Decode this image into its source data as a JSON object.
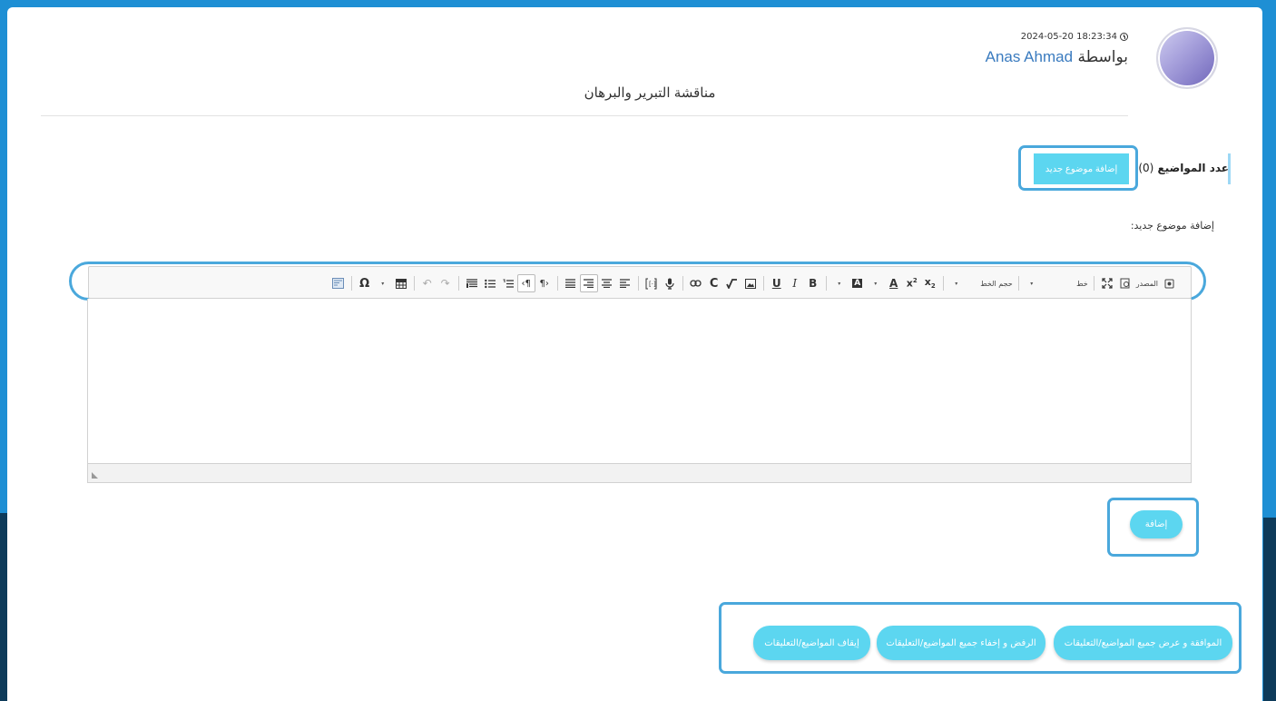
{
  "post": {
    "datetime": "2024-05-20 18:23:34",
    "by_label": "بواسطة",
    "author": "Anas Ahmad",
    "title": "مناقشة التبرير والبرهان"
  },
  "topics": {
    "label": "عدد المواضيع",
    "count": "(0)",
    "new_topic_button": "إضافة موضوع جديد"
  },
  "editor": {
    "section_label": "إضافة موضوع جديد:",
    "toolbar": {
      "source_label": "المصدر",
      "font_label": "خط",
      "font_size_label": "حجم الخط"
    }
  },
  "actions": {
    "add_button": "إضافة",
    "approve_all": "الموافقة و عرض جميع المواضيع/التعليقات",
    "reject_all": "الرفض و إخفاء جميع المواضيع/التعليقات",
    "stop": "إيقاف المواضيع/التعليقات"
  },
  "colors": {
    "accent": "#5cd6f0",
    "link": "#3a7bbf",
    "highlight": "#4aa8dc",
    "frame": "#1e8fd4"
  }
}
